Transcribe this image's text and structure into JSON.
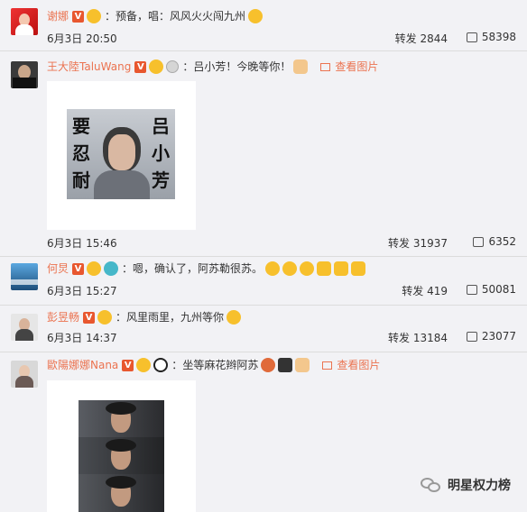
{
  "comments": [
    {
      "username": "谢娜",
      "text": "预备，唱：风风火火闯九州",
      "date": "6月3日 20:50",
      "repost_label": "转发",
      "repost_count": "2844",
      "likes": "58398"
    },
    {
      "username": "王大陸TaluWang",
      "text": "吕小芳！今晚等你！",
      "view_pic": "查看图片",
      "image_text": {
        "left": [
          "要",
          "忍",
          "耐"
        ],
        "right": [
          "吕",
          "小",
          "芳"
        ]
      },
      "date": "6月3日 15:46",
      "repost_label": "转发",
      "repost_count": "31937",
      "likes": "6352"
    },
    {
      "username": "何炅",
      "text": "嗯，确认了，阿苏勒很苏。",
      "date": "6月3日 15:27",
      "repost_label": "转发",
      "repost_count": "419",
      "likes": "50081"
    },
    {
      "username": "彭昱畅",
      "text": "风里雨里，九州等你",
      "date": "6月3日 14:37",
      "repost_label": "转发",
      "repost_count": "13184",
      "likes": "23077"
    },
    {
      "username": "歐陽娜娜Nana",
      "text": "坐等麻花辫阿苏",
      "view_pic": "查看图片"
    }
  ],
  "watermark": "明星权力榜",
  "colors": {
    "username": "#eb7350",
    "vip": "#e8572f",
    "bg": "#f2f2f5"
  }
}
